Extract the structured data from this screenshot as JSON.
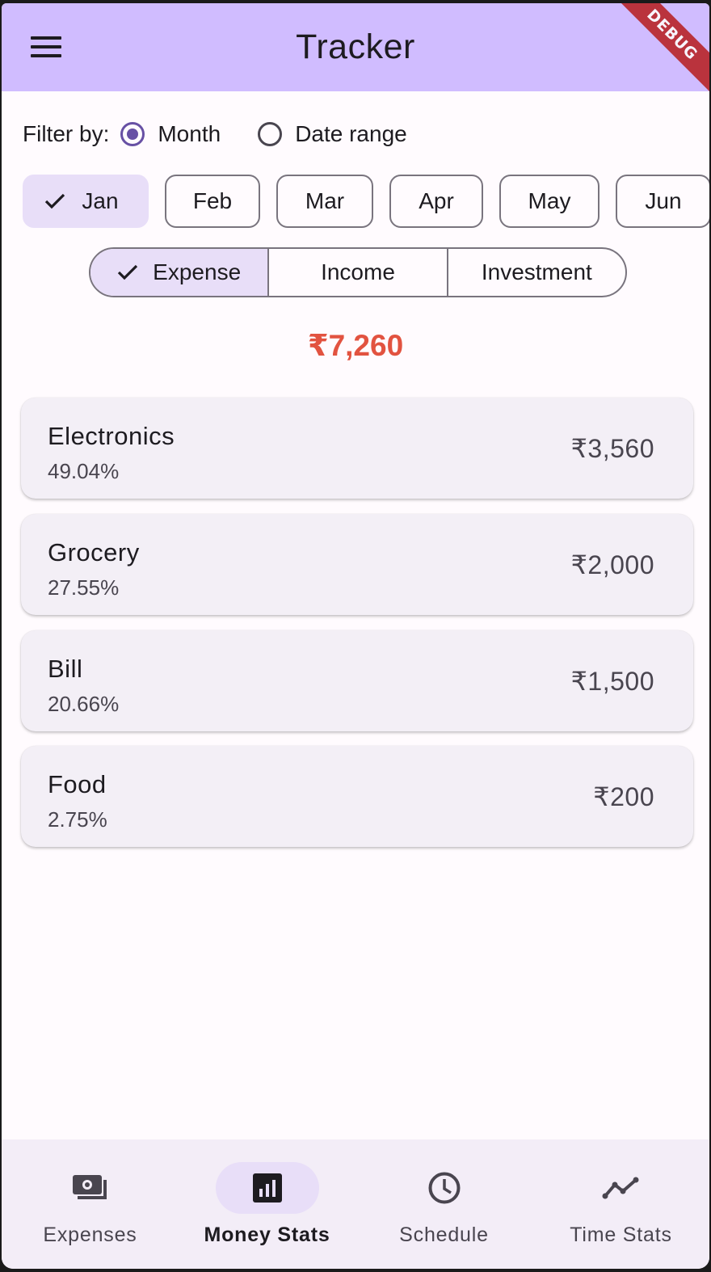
{
  "app": {
    "title": "Tracker",
    "debug_label": "DEBUG"
  },
  "filter": {
    "label": "Filter by:",
    "options": [
      {
        "label": "Month",
        "selected": true
      },
      {
        "label": "Date range",
        "selected": false
      }
    ]
  },
  "months": [
    {
      "label": "Jan",
      "selected": true
    },
    {
      "label": "Feb",
      "selected": false
    },
    {
      "label": "Mar",
      "selected": false
    },
    {
      "label": "Apr",
      "selected": false
    },
    {
      "label": "May",
      "selected": false
    },
    {
      "label": "Jun",
      "selected": false
    }
  ],
  "types": [
    {
      "label": "Expense",
      "selected": true
    },
    {
      "label": "Income",
      "selected": false
    },
    {
      "label": "Investment",
      "selected": false
    }
  ],
  "total": "₹7,260",
  "categories": [
    {
      "name": "Electronics",
      "percent": "49.04%",
      "amount": "₹3,560"
    },
    {
      "name": "Grocery",
      "percent": "27.55%",
      "amount": "₹2,000"
    },
    {
      "name": "Bill",
      "percent": "20.66%",
      "amount": "₹1,500"
    },
    {
      "name": "Food",
      "percent": "2.75%",
      "amount": "₹200"
    }
  ],
  "nav": [
    {
      "label": "Expenses",
      "icon": "payments-icon",
      "selected": false
    },
    {
      "label": "Money Stats",
      "icon": "bar-chart-icon",
      "selected": true
    },
    {
      "label": "Schedule",
      "icon": "clock-icon",
      "selected": false
    },
    {
      "label": "Time Stats",
      "icon": "trend-line-icon",
      "selected": false
    }
  ],
  "colors": {
    "app_bar": "#d0bcff",
    "accent": "#6750a4",
    "selected_bg": "#e8def8",
    "total_text": "#e25340",
    "card_bg": "#f3eff6"
  }
}
